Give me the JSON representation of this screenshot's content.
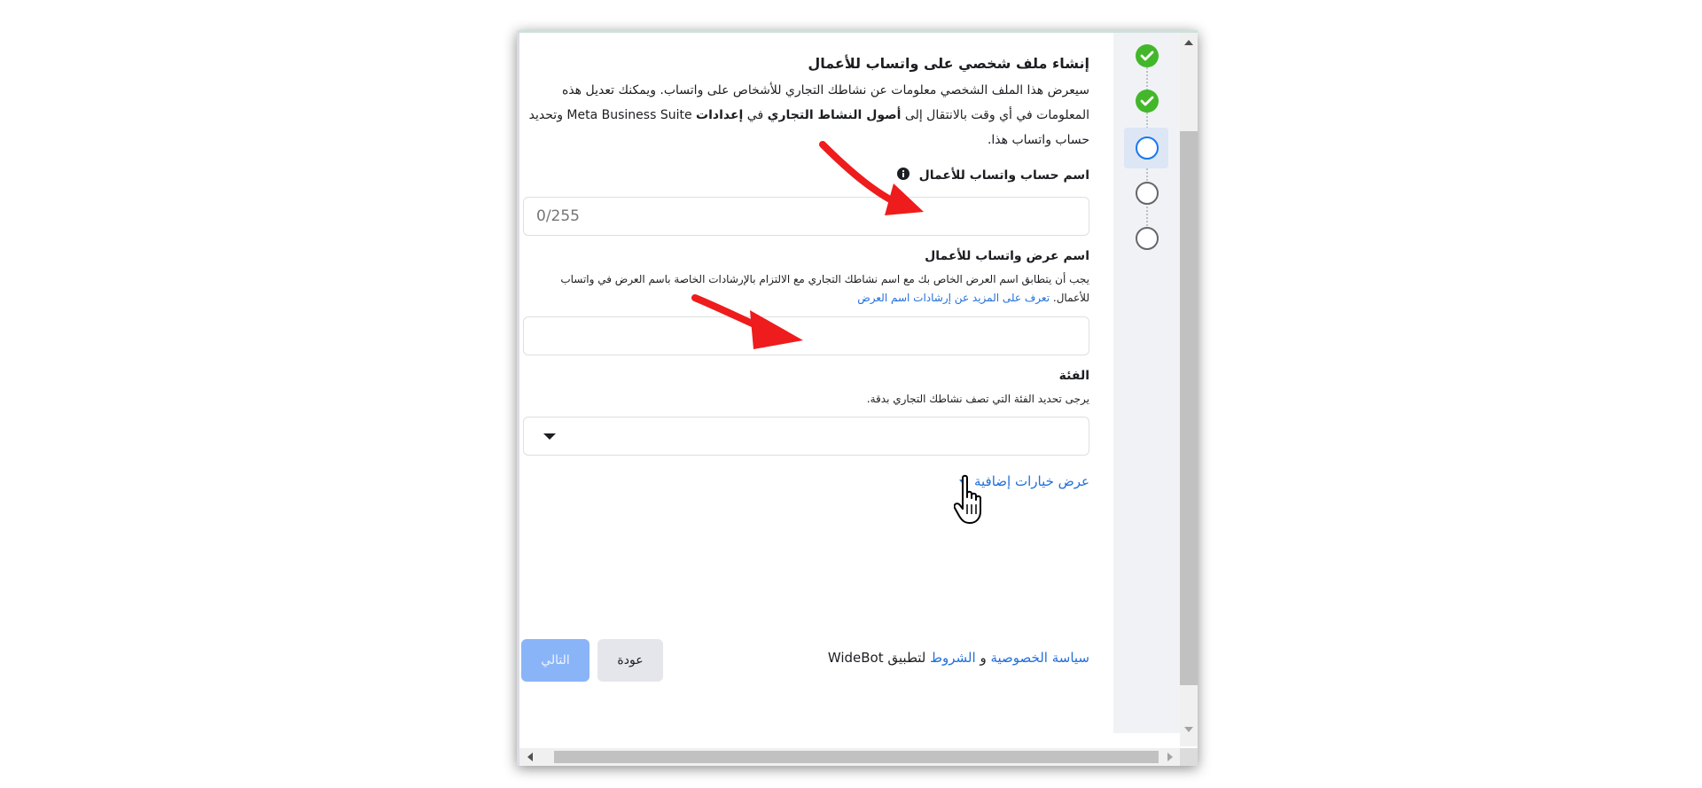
{
  "form": {
    "title": "إنشاء ملف شخصي على واتساب للأعمال",
    "description_part1": "سيعرض هذا الملف الشخصي معلومات عن نشاطك التجاري للأشخاص على واتساب. ويمكنك تعديل هذه المعلومات في أي وقت بالانتقال إلى",
    "description_bold1": "أصول النشاط التجاري",
    "description_part2": "في",
    "description_bold2": "إعدادات",
    "description_part3": "Meta Business Suite وتحديد حساب واتساب هذا.",
    "account_name_label": "اسم حساب واتساب للأعمال",
    "account_name_placeholder": "0/255",
    "display_name_label": "اسم عرض واتساب للأعمال",
    "display_name_helper": "يجب أن يتطابق اسم العرض الخاص بك مع اسم نشاطك التجاري مع الالتزام بالإرشادات الخاصة باسم العرض في واتساب للأعمال.",
    "display_name_link": "تعرف على المزيد عن إرشادات اسم العرض",
    "category_label": "الفئة",
    "category_helper": "يرجى تحديد الفئة التي تصف نشاطك التجاري بدقة.",
    "more_options": "عرض خيارات إضافية",
    "policy_link": "سياسة الخصوصية",
    "policy_and": "و",
    "terms_link": "الشروط",
    "policy_app": "لتطبيق WideBot",
    "back_button": "عودة",
    "next_button": "التالي"
  },
  "stepper": {
    "steps": [
      "done",
      "done",
      "current",
      "pending",
      "pending"
    ]
  },
  "colors": {
    "accent": "#1877f2",
    "success": "#42b72a",
    "link": "#216fdb",
    "annotation_arrow": "#ee1c1c"
  }
}
